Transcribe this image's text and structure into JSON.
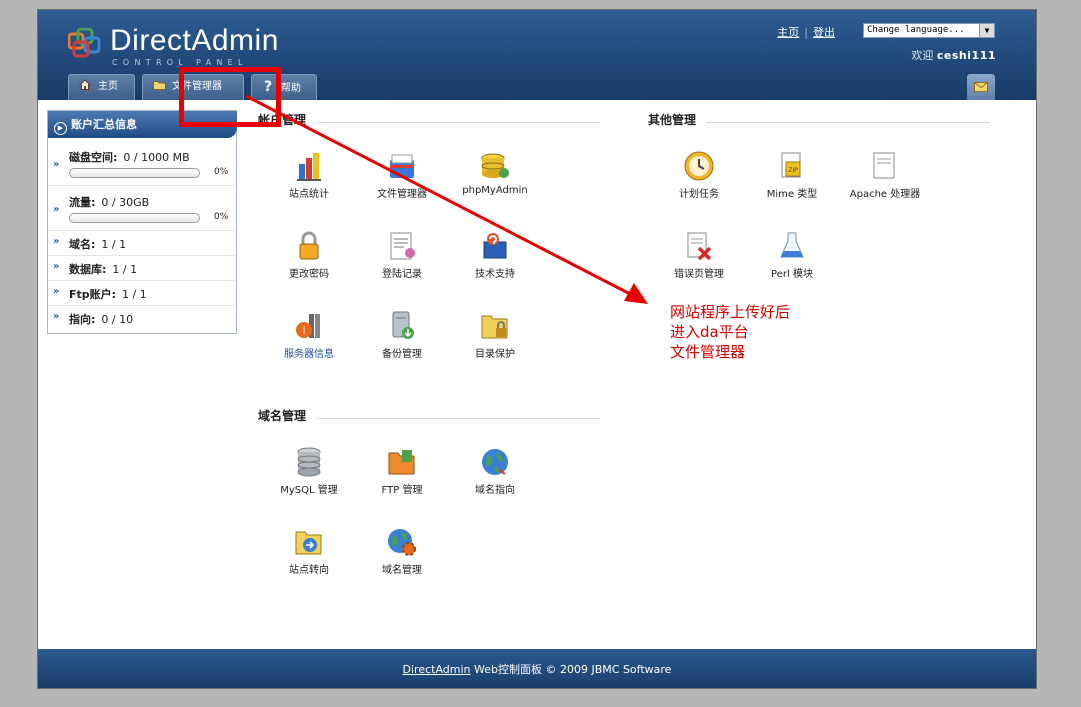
{
  "brand": {
    "name": "DirectAdmin",
    "subtitle": "CONTROL PANEL"
  },
  "top_links": {
    "home": "主页",
    "logout": "登出"
  },
  "language_select": {
    "value": "Change language..."
  },
  "welcome": {
    "prefix": "欢迎",
    "user": "ceshi111"
  },
  "tabs": [
    {
      "label": "主页",
      "icon": "home-icon"
    },
    {
      "label": "文件管理器",
      "icon": "folder-icon"
    },
    {
      "label": "帮助",
      "icon": "help-icon"
    }
  ],
  "mail_icon": "envelope-icon",
  "sidebar": {
    "title": "账户汇总信息",
    "disk": {
      "label": "磁盘空间:",
      "value": "0 / 1000 MB",
      "percent": "0%",
      "fraction": 0
    },
    "bandwidth": {
      "label": "流量:",
      "value": "0 / 30GB",
      "percent": "0%",
      "fraction": 0
    },
    "domains": {
      "label": "域名:",
      "value": "1 / 1"
    },
    "databases": {
      "label": "数据库:",
      "value": "1 / 1"
    },
    "ftp": {
      "label": "Ftp账户:",
      "value": "1 / 1"
    },
    "pointers": {
      "label": "指向:",
      "value": "0 / 10"
    }
  },
  "account_section": {
    "title": "帐户管理",
    "items": [
      {
        "label": "站点统计",
        "icon": "stats-icon"
      },
      {
        "label": "文件管理器",
        "icon": "file-manager-icon"
      },
      {
        "label": "phpMyAdmin",
        "icon": "database-stack-icon"
      },
      {
        "label": "更改密码",
        "icon": "lock-icon"
      },
      {
        "label": "登陆记录",
        "icon": "log-icon"
      },
      {
        "label": "技术支持",
        "icon": "support-book-icon"
      },
      {
        "label": "服务器信息",
        "icon": "server-info-icon"
      },
      {
        "label": "备份管理",
        "icon": "backup-icon"
      },
      {
        "label": "目录保护",
        "icon": "folder-lock-icon"
      }
    ]
  },
  "domain_section": {
    "title": "域名管理",
    "items": [
      {
        "label": "MySQL 管理",
        "icon": "mysql-db-icon"
      },
      {
        "label": "FTP 管理",
        "icon": "ftp-folder-icon"
      },
      {
        "label": "域名指向",
        "icon": "globe-icon"
      },
      {
        "label": "站点转向",
        "icon": "redirect-folder-icon"
      },
      {
        "label": "域名管理",
        "icon": "globe-gear-icon"
      }
    ]
  },
  "other_section": {
    "title": "其他管理",
    "items": [
      {
        "label": "计划任务",
        "icon": "clock-icon"
      },
      {
        "label": "Mime 类型",
        "icon": "zip-file-icon"
      },
      {
        "label": "Apache 处理器",
        "icon": "feather-doc-icon"
      },
      {
        "label": "错误页管理",
        "icon": "error-page-icon"
      },
      {
        "label": "Perl 模块",
        "icon": "flask-icon"
      }
    ]
  },
  "annotation": {
    "line1": "网站程序上传好后",
    "line2": "进入da平台",
    "line3": "文件管理器"
  },
  "footer": {
    "link": "DirectAdmin",
    "text": " Web控制面板 © 2009 JBMC Software"
  },
  "colors": {
    "header": "#21497b",
    "highlight": "#e60000",
    "annotation": "#d00000"
  }
}
